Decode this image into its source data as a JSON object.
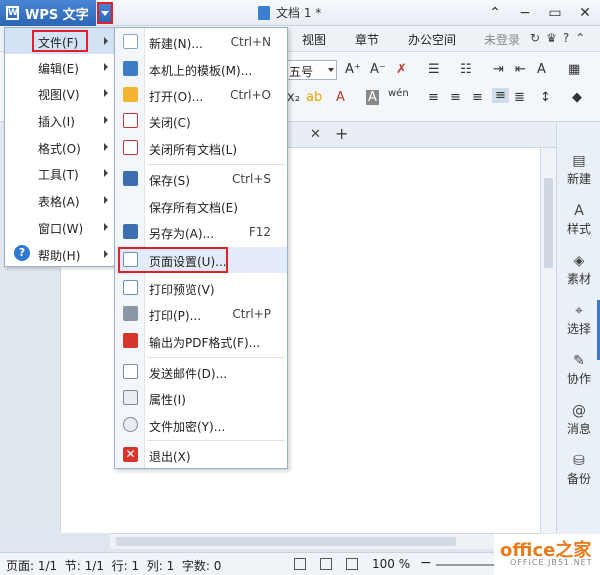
{
  "titlebar": {
    "app_name": "WPS 文字",
    "app_logo_letter": "W",
    "doc_title": "文档 1 *"
  },
  "ribbon": {
    "tabs": [
      "视图",
      "章节",
      "办公空间"
    ],
    "login": "未登录",
    "font_size": "五号"
  },
  "left_menu": {
    "items": [
      {
        "label": "文件(F)"
      },
      {
        "label": "编辑(E)"
      },
      {
        "label": "视图(V)"
      },
      {
        "label": "插入(I)"
      },
      {
        "label": "格式(O)"
      },
      {
        "label": "工具(T)"
      },
      {
        "label": "表格(A)"
      },
      {
        "label": "窗口(W)"
      },
      {
        "label": "帮助(H)"
      }
    ]
  },
  "file_menu": {
    "items": [
      {
        "label": "新建(N)...",
        "shortcut": "Ctrl+N",
        "icon": "new-document-icon"
      },
      {
        "label": "本机上的模板(M)...",
        "shortcut": "",
        "icon": "template-icon"
      },
      {
        "label": "打开(O)...",
        "shortcut": "Ctrl+O",
        "icon": "open-folder-icon"
      },
      {
        "label": "关闭(C)",
        "shortcut": "",
        "icon": "close-document-icon"
      },
      {
        "label": "关闭所有文档(L)",
        "shortcut": "",
        "icon": "close-all-icon"
      },
      {
        "label": "保存(S)",
        "shortcut": "Ctrl+S",
        "icon": "save-icon"
      },
      {
        "label": "保存所有文档(E)",
        "shortcut": "",
        "icon": ""
      },
      {
        "label": "另存为(A)...",
        "shortcut": "F12",
        "icon": "save-as-icon"
      },
      {
        "label": "页面设置(U)...",
        "shortcut": "",
        "icon": "page-setup-icon"
      },
      {
        "label": "打印预览(V)",
        "shortcut": "",
        "icon": "print-preview-icon"
      },
      {
        "label": "打印(P)...",
        "shortcut": "Ctrl+P",
        "icon": "printer-icon"
      },
      {
        "label": "输出为PDF格式(F)...",
        "shortcut": "",
        "icon": "pdf-icon"
      },
      {
        "label": "发送邮件(D)...",
        "shortcut": "",
        "icon": "mail-icon"
      },
      {
        "label": "属性(I)",
        "shortcut": "",
        "icon": "properties-icon"
      },
      {
        "label": "文件加密(Y)...",
        "shortcut": "",
        "icon": "encrypt-icon"
      },
      {
        "label": "退出(X)",
        "shortcut": "",
        "icon": "exit-icon"
      }
    ]
  },
  "right_panel": {
    "items": [
      "新建",
      "样式",
      "素材",
      "选择",
      "协作",
      "消息",
      "备份"
    ]
  },
  "statusbar": {
    "text": "页面: 1/1  节: 1/1  行: 1  列: 1  字数: 0",
    "zoom": "100 %"
  },
  "watermark": {
    "brand": "office之家",
    "domain": "OFFICE.JB51.NET"
  },
  "colors": {
    "accent": "#2b66b5",
    "highlight_border": "#e0202a",
    "watermark": "#e87b1c"
  }
}
